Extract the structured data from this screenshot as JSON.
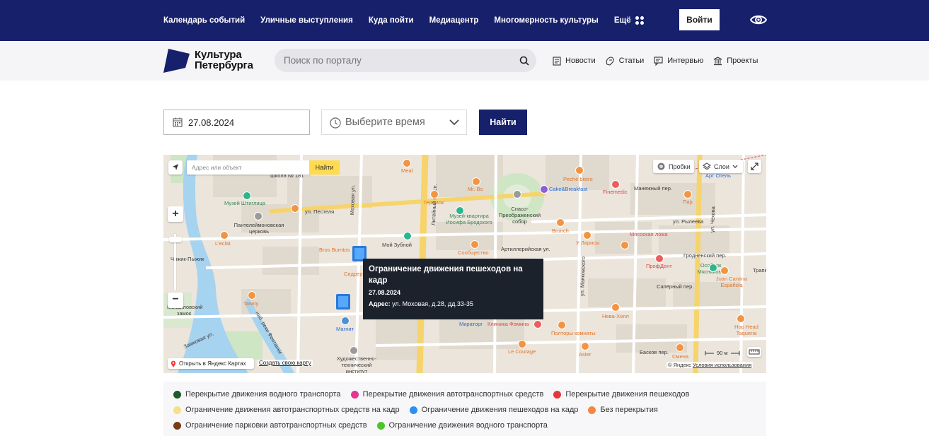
{
  "topnav": {
    "items": [
      "Календарь событий",
      "Уличные выступления",
      "Куда пойти",
      "Медиацентр",
      "Многомерность культуры"
    ],
    "more_label": "Ещё",
    "login_label": "Войти"
  },
  "header": {
    "logo_line1": "Культура",
    "logo_line2": "Петербурга",
    "search_placeholder": "Поиск по порталу",
    "links": [
      {
        "label": "Новости",
        "icon": "newspaper-icon"
      },
      {
        "label": "Статьи",
        "icon": "article-icon"
      },
      {
        "label": "Интервью",
        "icon": "interview-icon"
      },
      {
        "label": "Проекты",
        "icon": "museum-icon"
      }
    ]
  },
  "filters": {
    "date_value": "27.08.2024",
    "time_placeholder": "Выберите время",
    "find_label": "Найти"
  },
  "map": {
    "address_placeholder": "Адрес или объект",
    "address_find_label": "Найти",
    "zoom_in": "+",
    "zoom_out": "−",
    "traffic_label": "Пробки",
    "layers_label": "Слои",
    "open_yandex_label": "Открыть в Яндекс Картах",
    "create_map_label": "Создать свою карту",
    "copyright_prefix": "© Яндекс",
    "terms_label": "Условия использования",
    "scale_label": "90 м",
    "labels": [
      "Школа № 181",
      "Meal",
      "Mr. Bo",
      "Cake&Breakfast",
      "Peché bistro",
      "Finemedic",
      "Манежный пер.",
      "Арт Отель",
      "Пар",
      "Музей Штиглица",
      "ул. Пестеля",
      "Теремок",
      "Спасо-Преображенский собор",
      "Музей-квартира Иосифа Бродского",
      "Пантелеймоновская церковь",
      "L'eclat",
      "Brunch",
      "Мясоская ложа",
      "ул. Рылеева",
      "Моховая ул.",
      "Мой Зубной",
      "Сообщество",
      "Артиллерийская ул.",
      "У Ларисы",
      "Гродненский пер.",
      "Bros Burritos",
      "Сидрерия",
      "ПрофДент",
      "Особняк Мясникова",
      "Чижик-Пыжик",
      "Juan Cantina Española",
      "Сапёрный пер.",
      "Tawny",
      "Михайловский замок",
      "наб. реки Фонтанки",
      "Нева-Холл",
      "Магнит",
      "Мираторг",
      "Клиника Фомина",
      "Hop Head Taqueria",
      "Полторы комнаты",
      "Le Courage",
      "Aster",
      "Басков пер.",
      "Смена",
      "Художественно-технический институт",
      "Замковая ул.",
      "Литейный просп.",
      "ул. Маяковского",
      "ул. Чехова",
      "Трапеза"
    ]
  },
  "tooltip": {
    "title": "Ограничение движения пешеходов на кадр",
    "date": "27.08.2024",
    "address_label": "Адрес:",
    "address_value": "ул. Моховая, д.28, дд.33-35"
  },
  "legend": [
    [
      {
        "label": "Перекрытие движения водного транспорта",
        "color": "#1f5a2c"
      },
      {
        "label": "Перекрытие движения автотранспортных средств",
        "color": "#e5368c"
      },
      {
        "label": "Перекрытие движения пешеходов",
        "color": "#e23a3a"
      }
    ],
    [
      {
        "label": "Ограничение движения автотранспортных средств на кадр",
        "color": "#f5df8a"
      },
      {
        "label": "Ограничение движения пешеходов на кадр",
        "color": "#2f8ef0"
      },
      {
        "label": "Без перекрытия",
        "color": "#f4873f"
      }
    ],
    [
      {
        "label": "Ограничение парковки автотранспортных средств",
        "color": "#7a3a12"
      },
      {
        "label": "Ограничение движения водного транспорта",
        "color": "#4cc52c"
      }
    ]
  ],
  "colors": {
    "brand_navy": "#17206b",
    "map_marker": "#4aa3ff",
    "tooltip_bg": "#1b222c"
  }
}
